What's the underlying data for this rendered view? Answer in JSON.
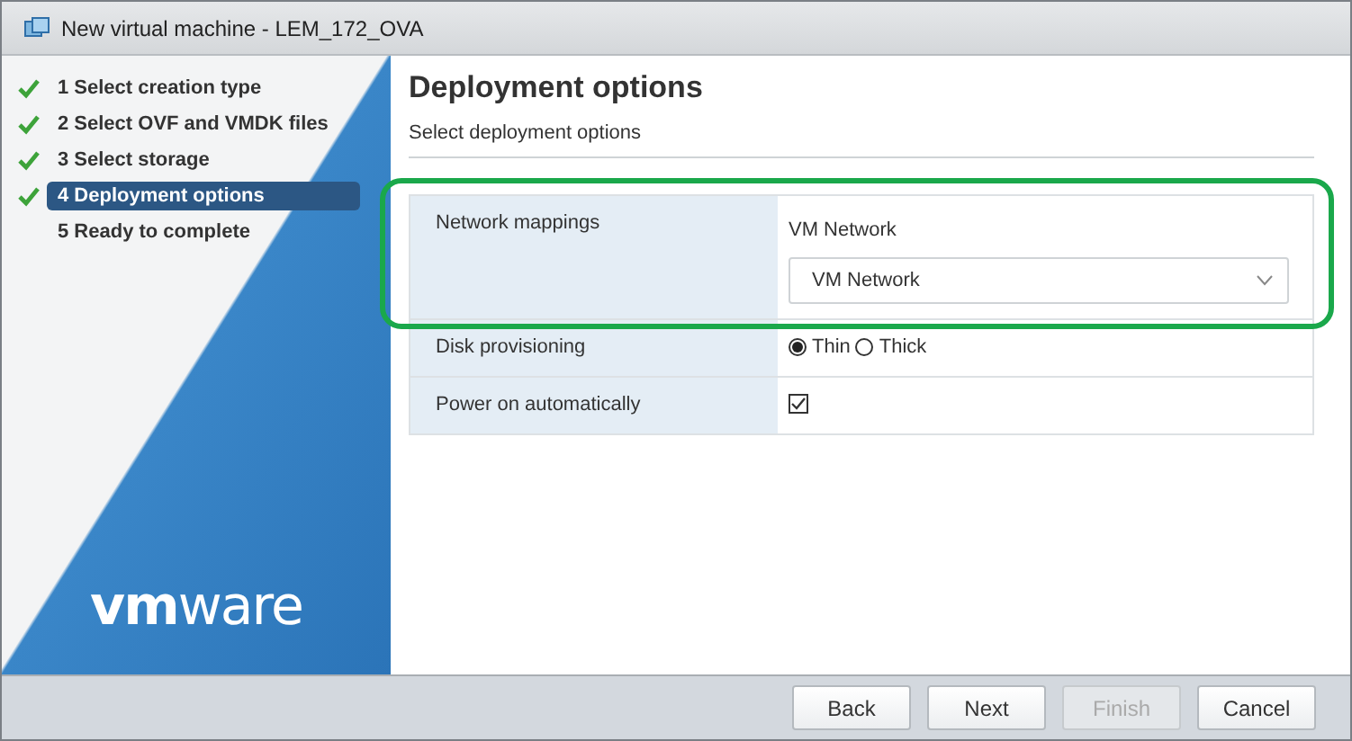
{
  "window": {
    "title": "New virtual machine - LEM_172_OVA"
  },
  "steps": [
    {
      "label": "1 Select creation type",
      "done": true,
      "selected": false
    },
    {
      "label": "2 Select OVF and VMDK files",
      "done": true,
      "selected": false
    },
    {
      "label": "3 Select storage",
      "done": true,
      "selected": false
    },
    {
      "label": "4 Deployment options",
      "done": true,
      "selected": true
    },
    {
      "label": "5 Ready to complete",
      "done": false,
      "selected": false
    }
  ],
  "logo": "**vm**ware",
  "page": {
    "title": "Deployment options",
    "subtitle": "Select deployment options"
  },
  "options": [
    {
      "kind": "select",
      "label": "Network mappings",
      "highlighted": true,
      "caption": "VM Network",
      "value": "VM Network"
    },
    {
      "kind": "radio",
      "label": "Disk provisioning",
      "highlighted": false,
      "choices": [
        {
          "label": "Thin",
          "selected": true
        },
        {
          "label": "Thick",
          "selected": false
        }
      ]
    },
    {
      "kind": "checkbox",
      "label": "Power on automatically",
      "highlighted": false,
      "checked": true
    }
  ],
  "buttons": [
    {
      "label": "Back",
      "disabled": false
    },
    {
      "label": "Next",
      "disabled": false
    },
    {
      "label": "Finish",
      "disabled": true
    },
    {
      "label": "Cancel",
      "disabled": false
    }
  ]
}
